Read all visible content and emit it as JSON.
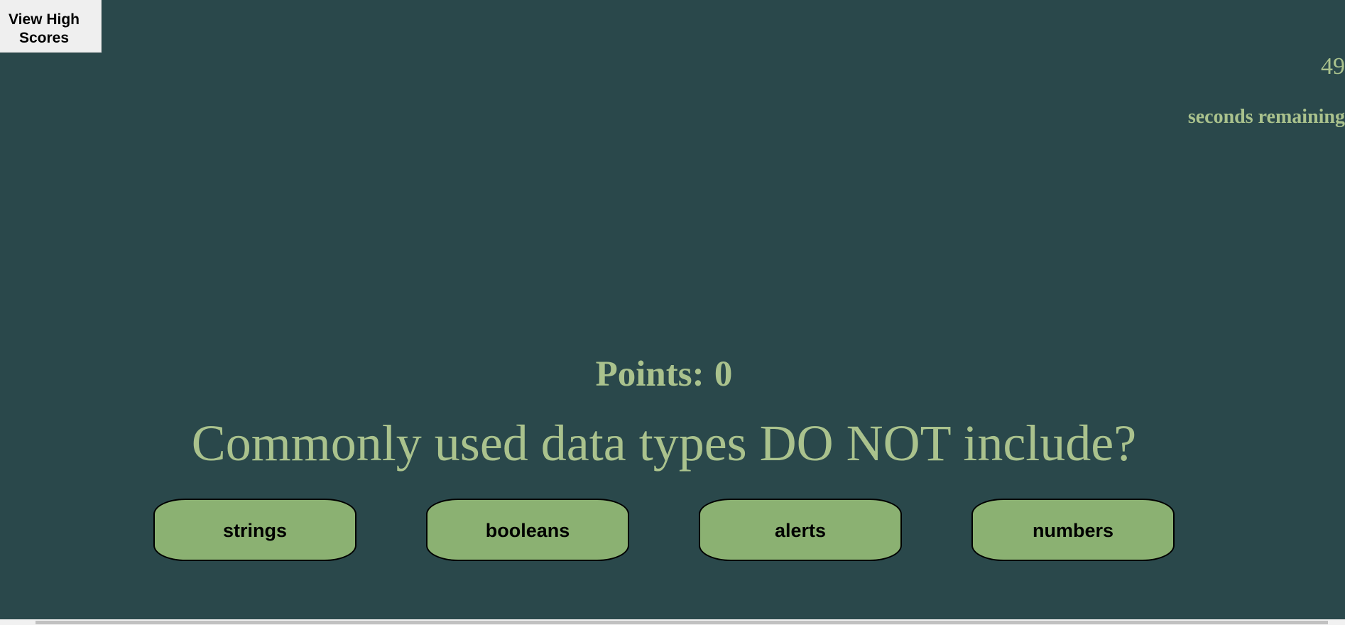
{
  "header": {
    "high_scores_label": "View High Scores"
  },
  "timer": {
    "seconds": "49",
    "label": "seconds remaining"
  },
  "score": {
    "label": "Points:",
    "value": "0"
  },
  "question": {
    "text": "Commonly used data types DO NOT include?"
  },
  "answers": [
    {
      "label": "strings"
    },
    {
      "label": "booleans"
    },
    {
      "label": "alerts"
    },
    {
      "label": "numbers"
    }
  ],
  "colors": {
    "background": "#2a484b",
    "text": "#aac28d",
    "answer_button": "#8bb172",
    "high_scores_button": "#efefef"
  }
}
